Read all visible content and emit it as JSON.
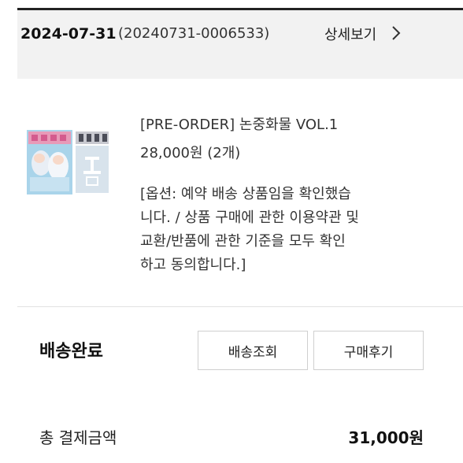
{
  "order": {
    "date": "2024-07-31",
    "number": "(20240731-0006533)",
    "detail_link": "상세보기"
  },
  "product": {
    "name": "[PRE-ORDER] 논중화물 VOL.1",
    "price": "28,000원 (2개)",
    "option_lines": [
      "[옵션: 예약 배송 상품임을 확인했습",
      "니다. / 상품 구매에 관한 이용약관 및",
      "교환/반품에 관한 기준을 모두 확인",
      "하고 동의합니다.]"
    ]
  },
  "delivery": {
    "status": "배송완료",
    "track_button": "배송조회",
    "review_button": "구매후기"
  },
  "payment": {
    "total_label": "총 결제금액",
    "total_amount": "31,000원"
  }
}
